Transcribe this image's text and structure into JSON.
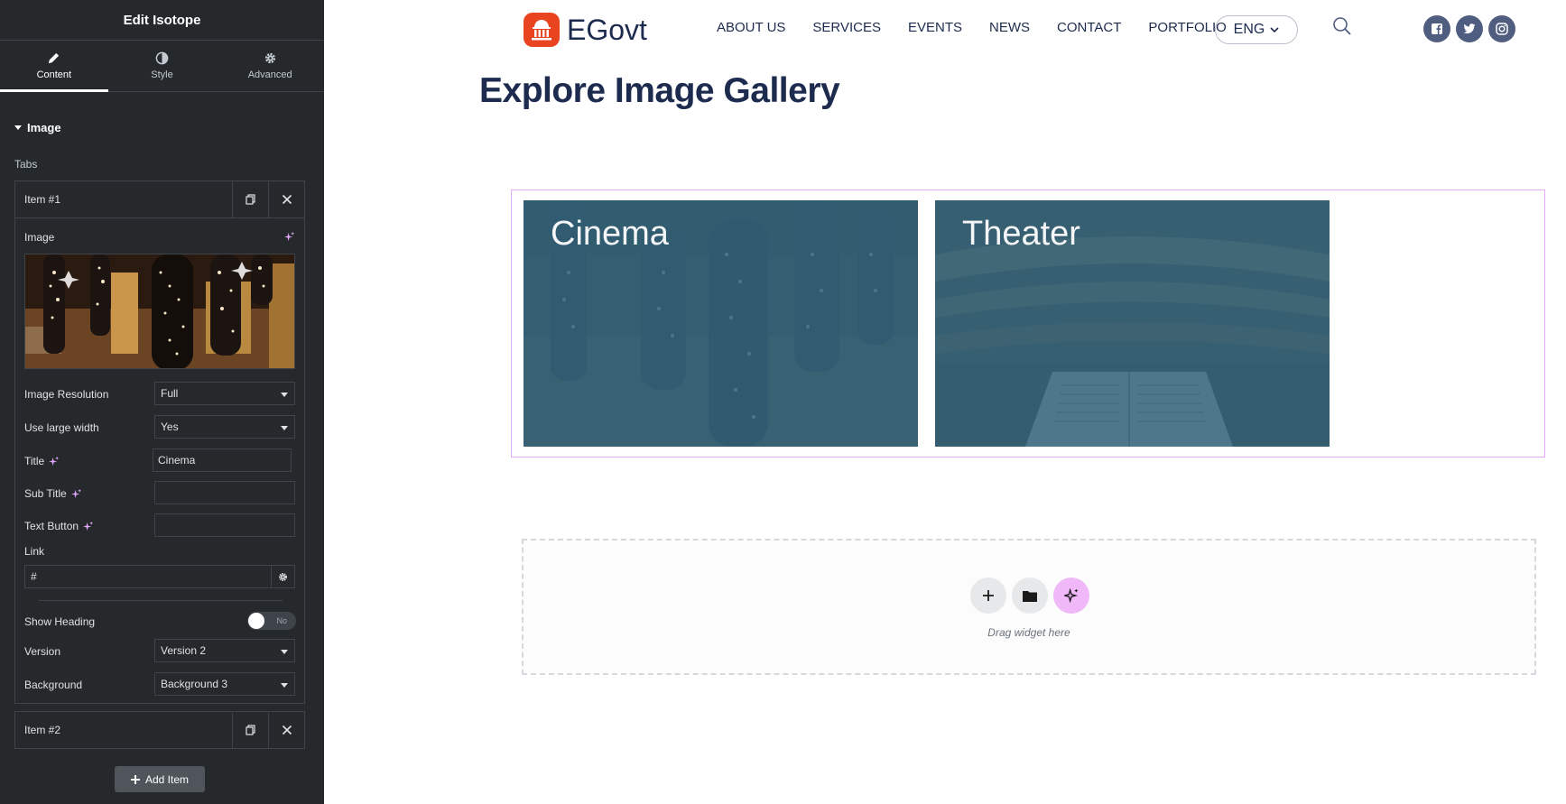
{
  "panel": {
    "title": "Edit Isotope",
    "tabs": [
      {
        "label": "Content",
        "icon": "pencil-icon",
        "active": true
      },
      {
        "label": "Style",
        "icon": "contrast-icon",
        "active": false
      },
      {
        "label": "Advanced",
        "icon": "gear-icon",
        "active": false
      }
    ],
    "section": "Image",
    "tabs_label": "Tabs",
    "item1": {
      "name": "Item #1",
      "image_label": "Image",
      "image_resolution_label": "Image Resolution",
      "image_resolution_value": "Full",
      "large_width_label": "Use large width",
      "large_width_value": "Yes",
      "title_label": "Title",
      "title_value": "Cinema",
      "subtitle_label": "Sub Title",
      "subtitle_value": "",
      "text_button_label": "Text Button",
      "text_button_value": "",
      "link_label": "Link",
      "link_value": "#",
      "show_heading_label": "Show Heading",
      "show_heading_value": "No",
      "version_label": "Version",
      "version_value": "Version 2",
      "background_label": "Background",
      "background_value": "Background 3"
    },
    "item2": {
      "name": "Item #2"
    },
    "add_item_label": "Add Item",
    "accent_color": "#e6a8ff"
  },
  "site": {
    "logo_text": "EGovt",
    "logo_color": "#e8441f",
    "nav": [
      "ABOUT US",
      "SERVICES",
      "EVENTS",
      "NEWS",
      "CONTACT",
      "PORTFOLIO"
    ],
    "language": "ENG",
    "socials": [
      "facebook-icon",
      "twitter-icon",
      "instagram-icon"
    ],
    "gallery_title": "Explore Image Gallery",
    "cards": [
      {
        "label": "Cinema"
      },
      {
        "label": "Theater"
      }
    ],
    "drop_zone_text": "Drag widget here",
    "overlay_color": "#356880"
  }
}
